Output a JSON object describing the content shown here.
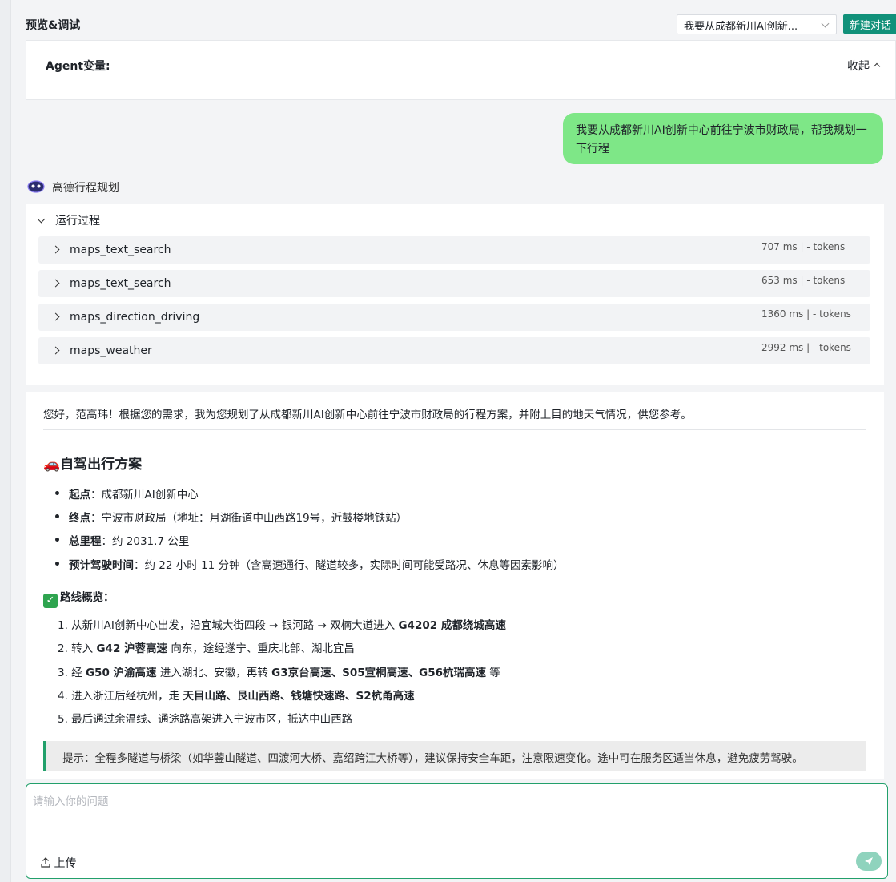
{
  "header": {
    "title": "预览&调试",
    "conversation_select": "我要从成都新川AI创新...",
    "new_chat_label": "新建对话"
  },
  "agent_vars": {
    "label": "Agent变量:",
    "collapse_label": "收起"
  },
  "user_message": "我要从成都新川AI创新中心前往宁波市财政局，帮我规划一下行程",
  "bot": {
    "name": "高德行程规划"
  },
  "run_process": {
    "title": "运行过程",
    "steps": [
      {
        "name": "maps_text_search",
        "meta": "707 ms  | - tokens"
      },
      {
        "name": "maps_text_search",
        "meta": "653 ms  | - tokens"
      },
      {
        "name": "maps_direction_driving",
        "meta": "1360 ms  | - tokens"
      },
      {
        "name": "maps_weather",
        "meta": "2992 ms  | - tokens"
      }
    ]
  },
  "answer": {
    "intro": "您好，范高玮！根据您的需求，我为您规划了从成都新川AI创新中心前往宁波市财政局的行程方案，并附上目的地天气情况，供您参考。",
    "section_title": "🚗自驾出行方案",
    "bullets": [
      {
        "label": "起点",
        "text": "：成都新川AI创新中心"
      },
      {
        "label": "终点",
        "text": "：宁波市财政局（地址：月湖街道中山西路19号，近鼓楼地铁站）"
      },
      {
        "label": "总里程",
        "text": "：约 2031.7 公里"
      },
      {
        "label": "预计驾驶时间",
        "text": "：约 22 小时 11 分钟（含高速通行、隧道较多，实际时间可能受路况、休息等因素影响）"
      }
    ],
    "overview_title": "路线概览：",
    "overview_check": "✓",
    "route_steps": [
      {
        "a": "1. 从新川AI创新中心出发，沿宜城大街四段 → 银河路 → 双楠大道进入 ",
        "b": "G4202 成都绕城高速",
        "c": ""
      },
      {
        "a": "2. 转入 ",
        "b": "G42 沪蓉高速",
        "c": " 向东，途经遂宁、重庆北部、湖北宜昌"
      },
      {
        "a": "3. 经 ",
        "b": "G50 沪渝高速",
        "c": " 进入湖北、安徽，再转 ",
        "d": "G3京台高速、S05宣桐高速、G56杭瑞高速",
        "e": " 等"
      },
      {
        "a": "4. 进入浙江后经杭州，走 ",
        "b": "天目山路、艮山西路、钱塘快速路、S2杭甬高速",
        "c": ""
      },
      {
        "a": "5. 最后通过余温线、通途路高架进入宁波市区，抵达中山西路",
        "b": "",
        "c": ""
      }
    ],
    "tip": "提示：全程多隧道与桥梁（如华蓥山隧道、四渡河大桥、嘉绍跨江大桥等），建议保持安全车距，注意限速变化。途中可在服务区适当休息，避免疲劳驾驶。"
  },
  "input": {
    "placeholder": "请输入你的问题",
    "upload_label": "上传"
  }
}
